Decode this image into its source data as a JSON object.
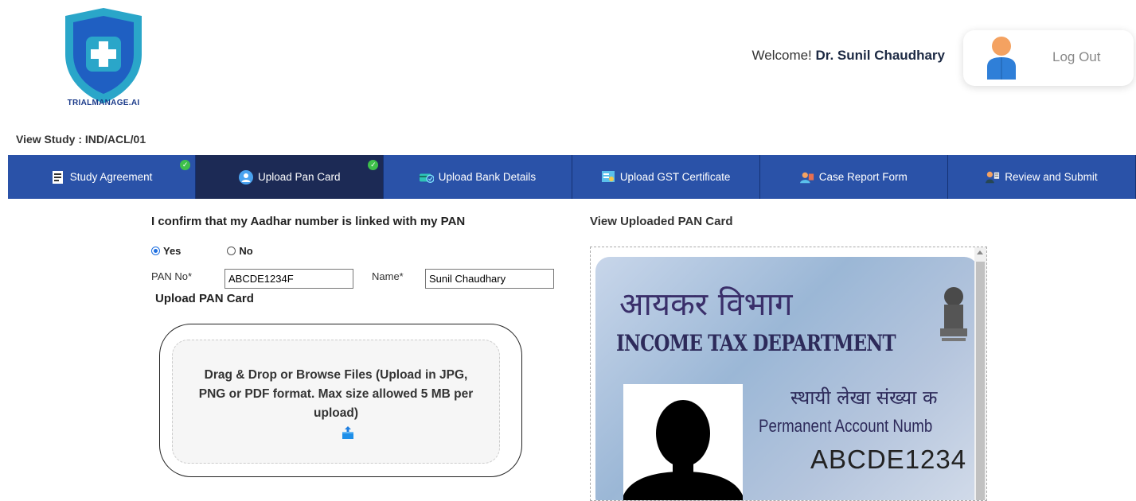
{
  "brand": {
    "name": "TRIALMANAGE.AI"
  },
  "header": {
    "welcome_prefix": "Welcome!",
    "user_name": "Dr. Sunil Chaudhary",
    "logout_label": "Log Out"
  },
  "study": {
    "title": "View Study : IND/ACL/01"
  },
  "tabs": [
    {
      "label": "Study Agreement",
      "completed": true,
      "active": false
    },
    {
      "label": "Upload Pan Card",
      "completed": true,
      "active": true
    },
    {
      "label": "Upload Bank Details",
      "completed": false,
      "active": false
    },
    {
      "label": "Upload GST Certificate",
      "completed": false,
      "active": false
    },
    {
      "label": "Case Report Form",
      "completed": false,
      "active": false
    },
    {
      "label": "Review and Submit",
      "completed": false,
      "active": false
    }
  ],
  "form": {
    "confirm_text": "I confirm that my Aadhar number is linked with my PAN",
    "yes_label": "Yes",
    "no_label": "No",
    "selected": "Yes",
    "pan_label": "PAN No*",
    "pan_value": "ABCDE1234F",
    "name_label": "Name*",
    "name_value": "Sunil Chaudhary",
    "upload_title": "Upload PAN Card",
    "drop_text": "Drag & Drop or Browse Files (Upload in JPG, PNG or PDF format. Max size allowed 5 MB per upload)"
  },
  "preview": {
    "title": "View Uploaded PAN Card",
    "card_hindi_title": "आयकर विभाग",
    "card_dept": "INCOME TAX DEPARTMENT",
    "card_hindi_sub": "स्थायी लेखा संख्या क",
    "card_pan_label": "Permanent Account Numb",
    "card_pan_number": "ABCDE1234"
  },
  "colors": {
    "tab_bg": "#2a52a8",
    "tab_active_bg": "#1c2a55",
    "check_green": "#3ec04a",
    "radio_blue": "#1f6fe0"
  }
}
